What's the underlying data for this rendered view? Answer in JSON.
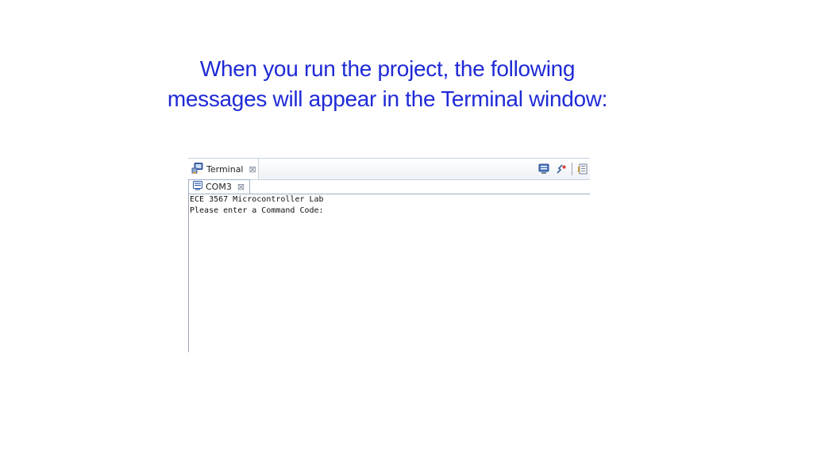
{
  "slide": {
    "title_line1": "When you run the project, the following",
    "title_line2": "messages will appear in the Terminal window:",
    "title_color": "#1f2ad6"
  },
  "terminal_view": {
    "tab_label": "Terminal",
    "tab_icon": "terminal-icon",
    "close_symbol": "⊠",
    "toolbar_icons": [
      "monitor-icon",
      "disconnect-icon",
      "scroll-lock-icon"
    ],
    "session": {
      "tab_label": "COM3",
      "tab_icon": "console-icon",
      "close_symbol": "⊠"
    },
    "output_lines": [
      "ECE 3567 Microcontroller Lab",
      "Please enter a Command Code:"
    ]
  }
}
